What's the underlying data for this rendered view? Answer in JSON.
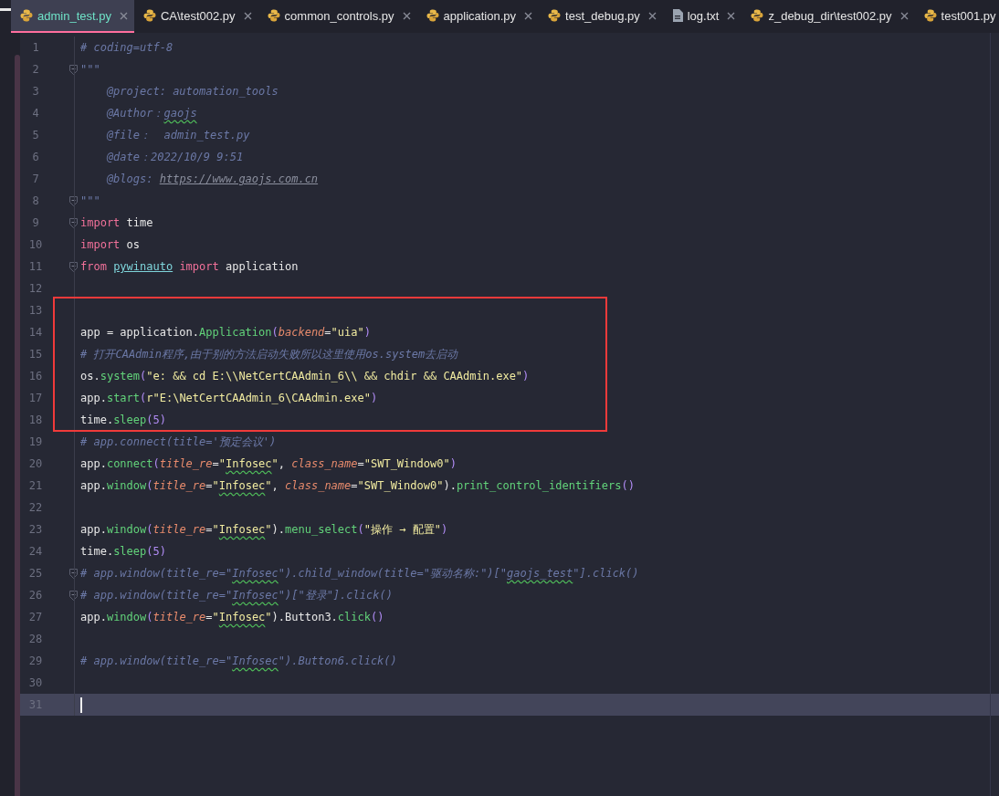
{
  "tabs": [
    {
      "label": "admin_test.py",
      "kind": "python",
      "selected": true
    },
    {
      "label": "CA\\test002.py",
      "kind": "python",
      "selected": false
    },
    {
      "label": "common_controls.py",
      "kind": "python",
      "selected": false
    },
    {
      "label": "application.py",
      "kind": "python",
      "selected": false
    },
    {
      "label": "test_debug.py",
      "kind": "python",
      "selected": false
    },
    {
      "label": "log.txt",
      "kind": "text",
      "selected": false
    },
    {
      "label": "z_debug_dir\\test002.py",
      "kind": "python",
      "selected": false
    },
    {
      "label": "test001.py",
      "kind": "python",
      "selected": false
    }
  ],
  "lines": [
    {
      "n": "1",
      "tokens": [
        {
          "text": "# coding=utf-8",
          "kind": "comment"
        }
      ]
    },
    {
      "n": "2",
      "fold": true,
      "tokens": [
        {
          "text": "\"\"\"",
          "kind": "doc"
        }
      ]
    },
    {
      "n": "3",
      "tokens": [
        {
          "text": "    @project: automation_tools",
          "kind": "doc"
        }
      ]
    },
    {
      "n": "4",
      "tokens": [
        {
          "text": "    @Author：",
          "kind": "doc"
        },
        {
          "text": "gaojs",
          "kind": "doc-typo"
        }
      ]
    },
    {
      "n": "5",
      "tokens": [
        {
          "text": "    @file：  admin_test.py",
          "kind": "doc"
        }
      ]
    },
    {
      "n": "6",
      "tokens": [
        {
          "text": "    @date：2022/10/9 9:51",
          "kind": "doc"
        }
      ]
    },
    {
      "n": "7",
      "tokens": [
        {
          "text": "    @blogs: ",
          "kind": "doc"
        },
        {
          "text": "https://www.gaojs.com.cn",
          "kind": "link"
        }
      ]
    },
    {
      "n": "8",
      "fold": true,
      "tokens": [
        {
          "text": "\"\"\"",
          "kind": "doc"
        }
      ]
    },
    {
      "n": "9",
      "fold": true,
      "tokens": [
        {
          "text": "import",
          "kind": "kw"
        },
        {
          "text": " time",
          "kind": "plain"
        }
      ]
    },
    {
      "n": "10",
      "tokens": [
        {
          "text": "import",
          "kind": "kw"
        },
        {
          "text": " os",
          "kind": "plain"
        }
      ]
    },
    {
      "n": "11",
      "fold": true,
      "tokens": [
        {
          "text": "from ",
          "kind": "kw"
        },
        {
          "text": "pywinauto",
          "kind": "module"
        },
        {
          "text": " import",
          "kind": "kw"
        },
        {
          "text": " application",
          "kind": "plain"
        }
      ]
    },
    {
      "n": "12"
    },
    {
      "n": "13",
      "boxed": true
    },
    {
      "n": "14",
      "boxed": true,
      "tokens": [
        {
          "text": "app = application.",
          "kind": "plain"
        },
        {
          "text": "Application",
          "kind": "fn"
        },
        {
          "text": "(",
          "kind": "paren"
        },
        {
          "text": "backend",
          "kind": "param"
        },
        {
          "text": "=",
          "kind": "plain"
        },
        {
          "text": "\"uia\"",
          "kind": "str"
        },
        {
          "text": ")",
          "kind": "paren"
        }
      ]
    },
    {
      "n": "15",
      "boxed": true,
      "tokens": [
        {
          "text": "# 打开CAAdmin程序,由于别的方法启动失败所以这里使用os.system去启动",
          "kind": "comment"
        }
      ]
    },
    {
      "n": "16",
      "boxed": true,
      "tokens": [
        {
          "text": "os.",
          "kind": "plain"
        },
        {
          "text": "system",
          "kind": "fn"
        },
        {
          "text": "(",
          "kind": "paren"
        },
        {
          "text": "\"e: && cd E:\\\\NetCertCAAdmin_6\\\\ && chdir && CAAdmin.exe\"",
          "kind": "str"
        },
        {
          "text": ")",
          "kind": "paren"
        }
      ]
    },
    {
      "n": "17",
      "boxed": true,
      "tokens": [
        {
          "text": "app.",
          "kind": "plain"
        },
        {
          "text": "start",
          "kind": "fn"
        },
        {
          "text": "(",
          "kind": "paren"
        },
        {
          "text": "r\"E:\\NetCertCAAdmin_6\\CAAdmin.exe\"",
          "kind": "str"
        },
        {
          "text": ")",
          "kind": "paren"
        }
      ]
    },
    {
      "n": "18",
      "boxed": true,
      "tokens": [
        {
          "text": "time.",
          "kind": "plain"
        },
        {
          "text": "sleep",
          "kind": "fn"
        },
        {
          "text": "(",
          "kind": "paren"
        },
        {
          "text": "5",
          "kind": "num"
        },
        {
          "text": ")",
          "kind": "paren"
        }
      ]
    },
    {
      "n": "19",
      "tokens": [
        {
          "text": "# app.connect(title='预定会议')",
          "kind": "comment"
        }
      ]
    },
    {
      "n": "20",
      "tokens": [
        {
          "text": "app.",
          "kind": "plain"
        },
        {
          "text": "connect",
          "kind": "fn"
        },
        {
          "text": "(",
          "kind": "paren"
        },
        {
          "text": "title_re",
          "kind": "param"
        },
        {
          "text": "=",
          "kind": "plain"
        },
        {
          "text": "\"",
          "kind": "str"
        },
        {
          "text": "Infosec",
          "kind": "str-typo"
        },
        {
          "text": "\"",
          "kind": "str"
        },
        {
          "text": ", ",
          "kind": "plain"
        },
        {
          "text": "class_name",
          "kind": "param"
        },
        {
          "text": "=",
          "kind": "plain"
        },
        {
          "text": "\"SWT_Window0\"",
          "kind": "str"
        },
        {
          "text": ")",
          "kind": "paren"
        }
      ]
    },
    {
      "n": "21",
      "tokens": [
        {
          "text": "app.",
          "kind": "plain"
        },
        {
          "text": "window",
          "kind": "fn"
        },
        {
          "text": "(",
          "kind": "paren"
        },
        {
          "text": "title_re",
          "kind": "param"
        },
        {
          "text": "=",
          "kind": "plain"
        },
        {
          "text": "\"",
          "kind": "str"
        },
        {
          "text": "Infosec",
          "kind": "str-typo"
        },
        {
          "text": "\"",
          "kind": "str"
        },
        {
          "text": ", ",
          "kind": "plain"
        },
        {
          "text": "class_name",
          "kind": "param"
        },
        {
          "text": "=",
          "kind": "plain"
        },
        {
          "text": "\"SWT_Window0\"",
          "kind": "str"
        },
        {
          "text": ").",
          "kind": "plain"
        },
        {
          "text": "print_control_identifiers",
          "kind": "fn"
        },
        {
          "text": "()",
          "kind": "paren"
        }
      ]
    },
    {
      "n": "22"
    },
    {
      "n": "23",
      "tokens": [
        {
          "text": "app.",
          "kind": "plain"
        },
        {
          "text": "window",
          "kind": "fn"
        },
        {
          "text": "(",
          "kind": "paren"
        },
        {
          "text": "title_re",
          "kind": "param"
        },
        {
          "text": "=",
          "kind": "plain"
        },
        {
          "text": "\"",
          "kind": "str"
        },
        {
          "text": "Infosec",
          "kind": "str-typo"
        },
        {
          "text": "\"",
          "kind": "str"
        },
        {
          "text": ").",
          "kind": "plain"
        },
        {
          "text": "menu_select",
          "kind": "fn"
        },
        {
          "text": "(",
          "kind": "paren"
        },
        {
          "text": "\"操作 → 配置\"",
          "kind": "str"
        },
        {
          "text": ")",
          "kind": "paren"
        }
      ]
    },
    {
      "n": "24",
      "tokens": [
        {
          "text": "time.",
          "kind": "plain"
        },
        {
          "text": "sleep",
          "kind": "fn"
        },
        {
          "text": "(",
          "kind": "paren"
        },
        {
          "text": "5",
          "kind": "num"
        },
        {
          "text": ")",
          "kind": "paren"
        }
      ]
    },
    {
      "n": "25",
      "fold": true,
      "tokens": [
        {
          "text": "# app.window(title_re=\"",
          "kind": "comment"
        },
        {
          "text": "Infosec",
          "kind": "comment-typo"
        },
        {
          "text": "\").child_window(title=\"驱动名称:\")[\"",
          "kind": "comment"
        },
        {
          "text": "gaojs_test",
          "kind": "comment-typo"
        },
        {
          "text": "\"].click()",
          "kind": "comment"
        }
      ]
    },
    {
      "n": "26",
      "fold": true,
      "tokens": [
        {
          "text": "# app.window(title_re=\"",
          "kind": "comment"
        },
        {
          "text": "Infosec",
          "kind": "comment-typo"
        },
        {
          "text": "\")[\"登录\"].click()",
          "kind": "comment"
        }
      ]
    },
    {
      "n": "27",
      "tokens": [
        {
          "text": "app.",
          "kind": "plain"
        },
        {
          "text": "window",
          "kind": "fn"
        },
        {
          "text": "(",
          "kind": "paren"
        },
        {
          "text": "title_re",
          "kind": "param"
        },
        {
          "text": "=",
          "kind": "plain"
        },
        {
          "text": "\"",
          "kind": "str"
        },
        {
          "text": "Infosec",
          "kind": "str-typo"
        },
        {
          "text": "\"",
          "kind": "str"
        },
        {
          "text": ").Button3.",
          "kind": "plain"
        },
        {
          "text": "click",
          "kind": "fn"
        },
        {
          "text": "()",
          "kind": "paren"
        }
      ]
    },
    {
      "n": "28"
    },
    {
      "n": "29",
      "tokens": [
        {
          "text": "# app.window(title_re=\"",
          "kind": "comment"
        },
        {
          "text": "Infosec",
          "kind": "comment-typo"
        },
        {
          "text": "\").Button6.click()",
          "kind": "comment"
        }
      ]
    },
    {
      "n": "30"
    },
    {
      "n": "31",
      "current": true
    }
  ]
}
